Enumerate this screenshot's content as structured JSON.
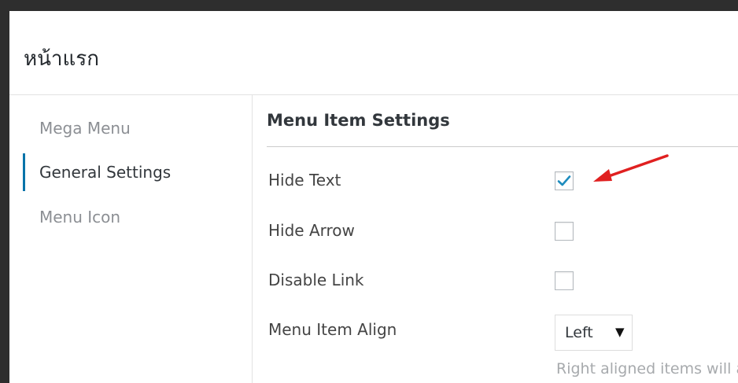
{
  "header": {
    "title": "หน้าแรก"
  },
  "sidebar": {
    "items": [
      {
        "label": "Mega Menu",
        "active": false
      },
      {
        "label": "General Settings",
        "active": true
      },
      {
        "label": "Menu Icon",
        "active": false
      }
    ]
  },
  "main": {
    "section_title": "Menu Item Settings",
    "settings": [
      {
        "label": "Hide Text",
        "type": "checkbox",
        "checked": true
      },
      {
        "label": "Hide Arrow",
        "type": "checkbox",
        "checked": false
      },
      {
        "label": "Disable Link",
        "type": "checkbox",
        "checked": false
      },
      {
        "label": "Menu Item Align",
        "type": "select",
        "value": "Left"
      }
    ],
    "align_hint": "Right aligned items will a"
  },
  "icons": {
    "checkmark": "check-icon",
    "caret": "caret-down-icon",
    "annotation": "red-arrow-icon"
  },
  "colors": {
    "accent": "#0073aa",
    "annotation_arrow": "#e02020",
    "border_dark": "#2e2e2e"
  }
}
